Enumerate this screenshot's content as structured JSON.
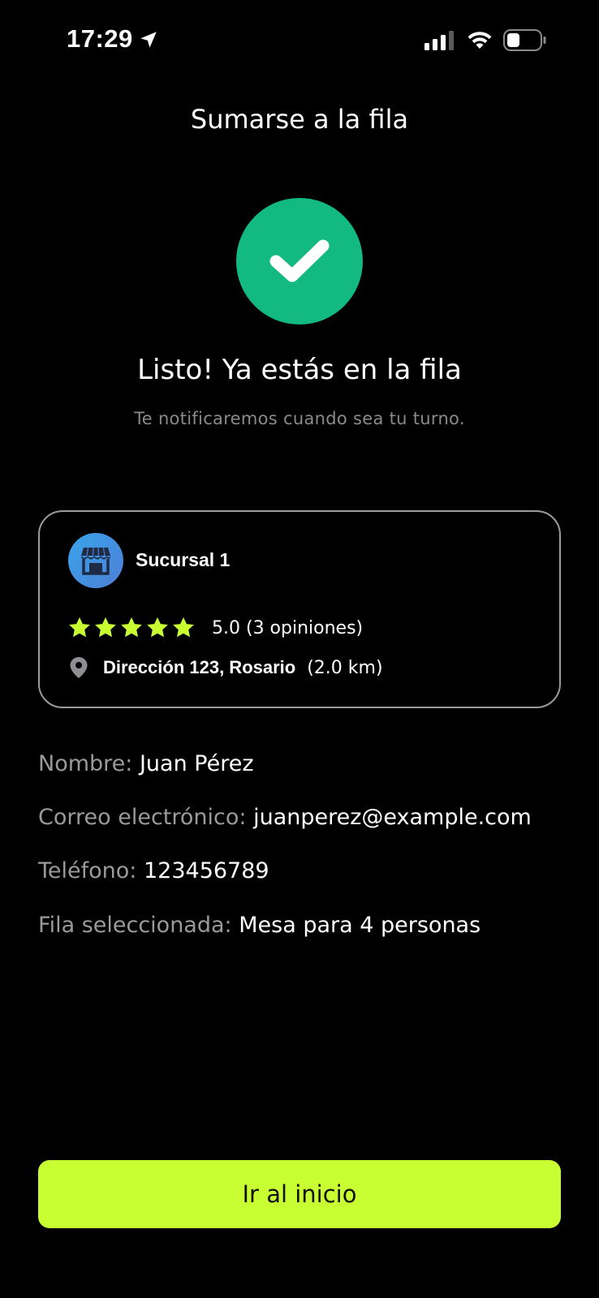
{
  "status_bar": {
    "time": "17:29"
  },
  "header": {
    "title": "Sumarse a la fila"
  },
  "success": {
    "title": "Listo! Ya estás en la fila",
    "subtitle": "Te notificaremos cuando sea tu turno."
  },
  "branch": {
    "name": "Sucursal 1",
    "rating_text": "5.0 (3 opiniones)",
    "stars": 5,
    "address": "Dirección 123, Rosario",
    "distance": "(2.0 km)"
  },
  "details": {
    "name_label": "Nombre:",
    "name_value": "Juan Pérez",
    "email_label": "Correo electrónico:",
    "email_value": "juanperez@example.com",
    "phone_label": "Teléfono:",
    "phone_value": "123456789",
    "queue_label": "Fila seleccionada:",
    "queue_value": "Mesa para 4 personas"
  },
  "actions": {
    "home_label": "Ir al inicio"
  },
  "colors": {
    "background": "#000000",
    "success": "#12b981",
    "accent": "#c8ff32",
    "star": "#c8ff32",
    "muted": "#8a8a8a"
  },
  "icons": [
    "location-arrow-icon",
    "signal-icon",
    "wifi-icon",
    "battery-icon",
    "check-icon",
    "store-icon",
    "star-icon",
    "map-pin-icon"
  ]
}
